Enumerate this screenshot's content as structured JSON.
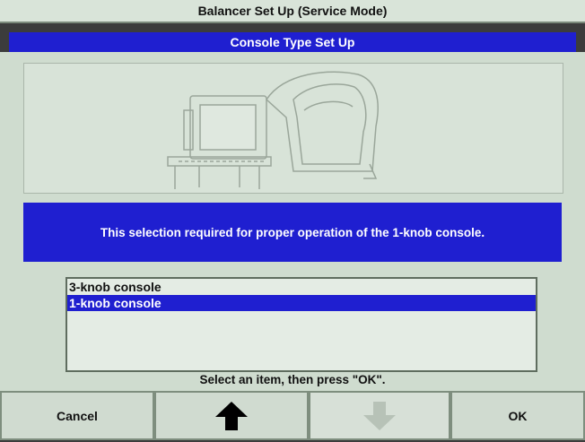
{
  "window": {
    "title": "Balancer Set Up (Service Mode)",
    "subtitle": "Console Type Set Up"
  },
  "message": "This selection required for proper operation of the 1-knob console.",
  "list": {
    "items": [
      "3-knob console",
      "1-knob console"
    ],
    "selected_index": 1
  },
  "hint": "Select an item, then press \"OK\".",
  "buttons": {
    "cancel": "Cancel",
    "up_icon": "up-arrow-icon",
    "down_icon": "down-arrow-icon",
    "down_state": "disabled",
    "ok": "OK"
  },
  "colors": {
    "accent_blue": "#1f1fd0",
    "panel": "#cfdccf"
  }
}
